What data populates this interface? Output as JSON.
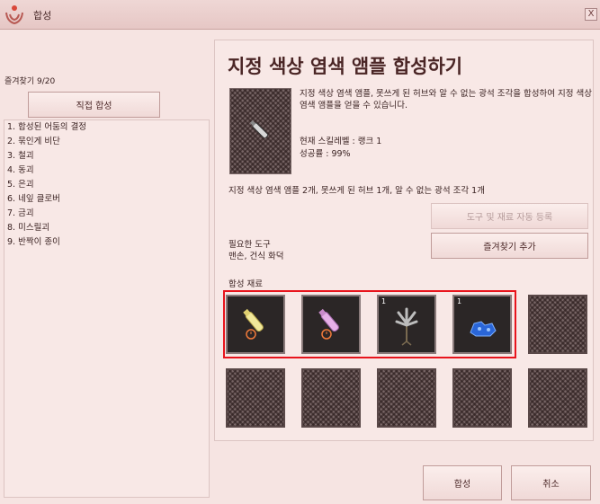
{
  "window": {
    "title": "합성",
    "close_label": "X"
  },
  "left": {
    "favorites_count": "즐겨찾기 9/20",
    "direct_synthesis_label": "직접 합성",
    "recipes": [
      "1. 합성된 어둠의 결정",
      "2. 묶인게 비단",
      "3. 철괴",
      "4. 동괴",
      "5. 은괴",
      "6. 네잎 클로버",
      "7. 금괴",
      "8. 미스릴괴",
      "9. 반짝이 종이"
    ]
  },
  "detail": {
    "title": "지정 색상 염색 앰플 합성하기",
    "description": "지정 색상 염색 앰플, 못쓰게 된 허브와 알 수 없는 광석 조각을 합성하여 지정 색상 염색 앰플을 얻을 수 있습니다.",
    "skill_level": "현재 스킬레벨 : 랭크 1",
    "success_rate": "성공률 : 99%",
    "requirements": "지정 색상 염색 앰플 2개, 못쓰게 된 허브 1개, 알 수 없는 광석 조각 1개",
    "auto_register_label": "도구 및 재료 자동 등록",
    "add_favorite_label": "즐겨찾기 추가",
    "tools_label": "필요한 도구",
    "tools_value": "맨손, 건식 화덕",
    "materials_label": "합성 재료",
    "materials": [
      {
        "icon": "yellow-ampoule-icon",
        "count": ""
      },
      {
        "icon": "pink-ampoule-icon",
        "count": ""
      },
      {
        "icon": "withered-herb-icon",
        "count": "1"
      },
      {
        "icon": "blue-ore-fragment-icon",
        "count": "1"
      }
    ]
  },
  "footer": {
    "synthesize_label": "합성",
    "cancel_label": "취소"
  },
  "colors": {
    "highlight": "#e8141c",
    "background": "#f6e4e2"
  }
}
